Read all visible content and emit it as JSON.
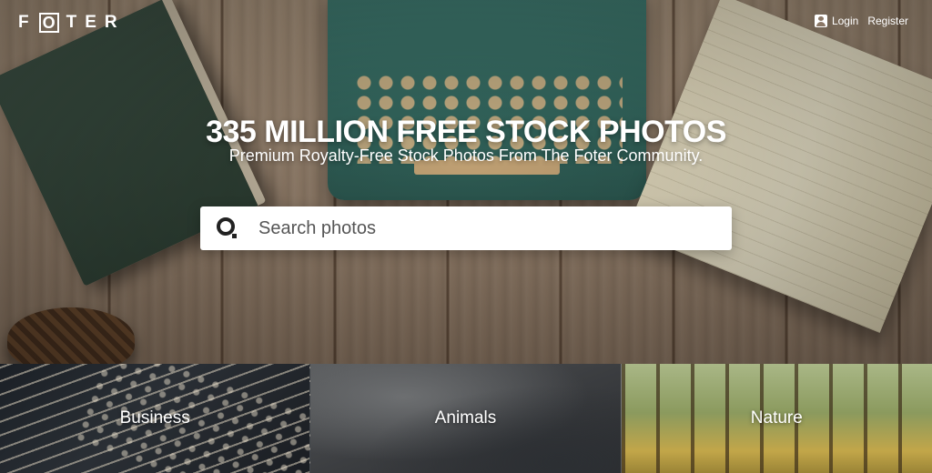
{
  "brand": {
    "letters_before": "F",
    "boxed_letter": "O",
    "letters_after": "TER"
  },
  "auth": {
    "login_label": "Login",
    "register_label": "Register",
    "user_icon": "user-icon"
  },
  "hero": {
    "headline": "335 MILLION FREE STOCK PHOTOS",
    "subline": "Premium Royalty-Free Stock Photos From The Foter Community."
  },
  "search": {
    "placeholder": "Search photos",
    "value": "",
    "icon": "search-icon"
  },
  "categories": [
    {
      "label": "Business"
    },
    {
      "label": "Animals"
    },
    {
      "label": "Nature"
    }
  ],
  "colors": {
    "text_on_image": "#ffffff",
    "search_bg": "#ffffff",
    "search_icon": "#222222"
  }
}
